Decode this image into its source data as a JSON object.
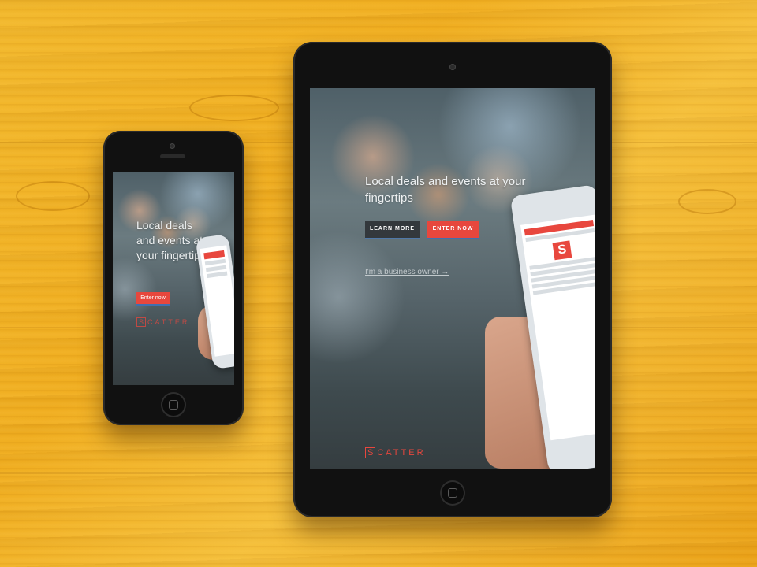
{
  "ipad": {
    "headline": "Local deals and events at your fingertips",
    "learn_more_label": "LEARN MORE",
    "enter_now_label": "ENTER NOW",
    "business_link": "I'm a business owner →",
    "logo_letter": "S",
    "logo_rest": "CATTER"
  },
  "iphone": {
    "headline": "Local deals and events at your fingertips",
    "enter_now_label": "Enter now",
    "logo_letter": "S",
    "logo_rest": "CATTER"
  },
  "colors": {
    "accent_red": "#e7473d",
    "button_dark": "#33383c",
    "wood": "#f0ad1f"
  }
}
